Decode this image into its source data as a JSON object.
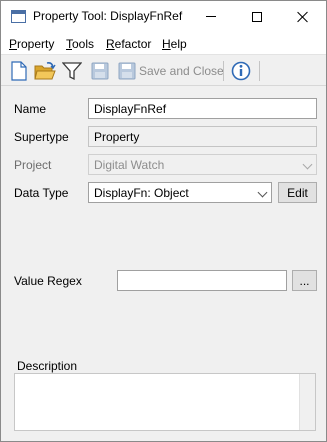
{
  "window": {
    "title": "Property Tool: DisplayFnRef"
  },
  "menu": {
    "items": [
      {
        "label": "Property",
        "mnemonic": "P",
        "rest": "roperty"
      },
      {
        "label": "Tools",
        "mnemonic": "T",
        "rest": "ools"
      },
      {
        "label": "Refactor",
        "mnemonic": "R",
        "rest": "efactor"
      },
      {
        "label": "Help",
        "mnemonic": "H",
        "rest": "elp"
      }
    ]
  },
  "toolbar": {
    "icons": [
      "new-document-icon",
      "open-folder-icon",
      "filter-icon",
      "save-icon",
      "save-and-close-icon",
      "info-icon"
    ],
    "save_close_label": "Save and Close"
  },
  "form": {
    "name_label": "Name",
    "name_value": "DisplayFnRef",
    "supertype_label": "Supertype",
    "supertype_value": "Property",
    "project_label": "Project",
    "project_value": "Digital Watch",
    "datatype_label": "Data Type",
    "datatype_value": "DisplayFn: Object",
    "edit_label": "Edit",
    "regex_label": "Value Regex",
    "regex_value": "",
    "regex_button_label": "...",
    "description_label": "Description",
    "description_value": ""
  },
  "colors": {
    "window_bg": "#f0f0f0",
    "titlebar_bg": "#ffffff",
    "icon_blue": "#2f6ab6",
    "folder_yellow": "#e8b63a",
    "disabled_text": "#8d8d8d"
  }
}
